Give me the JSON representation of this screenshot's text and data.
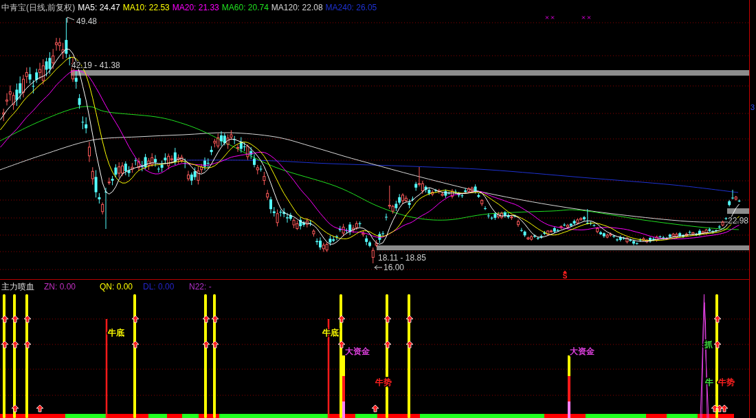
{
  "chart_header": {
    "title": "中青宝(日线,前复权)",
    "moving_averages": [
      {
        "label": "MA5: 24.47",
        "color": "#ffffff"
      },
      {
        "label": "MA10: 22.53",
        "color": "#ffff00"
      },
      {
        "label": "MA20: 21.33",
        "color": "#ff00ff"
      },
      {
        "label": "MA60: 20.74",
        "color": "#20e020"
      },
      {
        "label": "MA120: 22.08",
        "color": "#d8d8d8"
      },
      {
        "label": "MA240: 26.05",
        "color": "#1e32d2"
      }
    ]
  },
  "price_chart": {
    "annotations": [
      {
        "kind": "high",
        "text": "49.48"
      },
      {
        "kind": "band",
        "text": "42.19 - 41.38"
      },
      {
        "kind": "band",
        "text": "18.11 - 18.85"
      },
      {
        "kind": "low",
        "text": "16.00"
      },
      {
        "kind": "band",
        "text": "22.98"
      }
    ],
    "signal_mark": "S"
  },
  "right_axis": {
    "labels": [
      "3"
    ]
  },
  "indicator_header": {
    "title": "主力喷血",
    "values": [
      {
        "label": "ZN: 0.00",
        "color": "#c030c0"
      },
      {
        "label": "QN: 0.00",
        "color": "#ffff00"
      },
      {
        "label": "DL: 0.00",
        "color": "#2424c8"
      },
      {
        "label": "N22: -",
        "color": "#b030c8"
      }
    ]
  },
  "indicator_chart": {
    "signals": [
      {
        "text": "牛底",
        "color": "#ffff00"
      },
      {
        "text": "牛底",
        "color": "#ffff00"
      },
      {
        "text": "大资金",
        "color": "#e040e0"
      },
      {
        "text": "牛势",
        "color": "#ff2020"
      },
      {
        "text": "大资金",
        "color": "#e040e0"
      },
      {
        "text": "抓",
        "color": "#40e040"
      },
      {
        "text": "牛",
        "color": "#40e040"
      },
      {
        "text": "牛势",
        "color": "#ff2020"
      }
    ]
  }
}
